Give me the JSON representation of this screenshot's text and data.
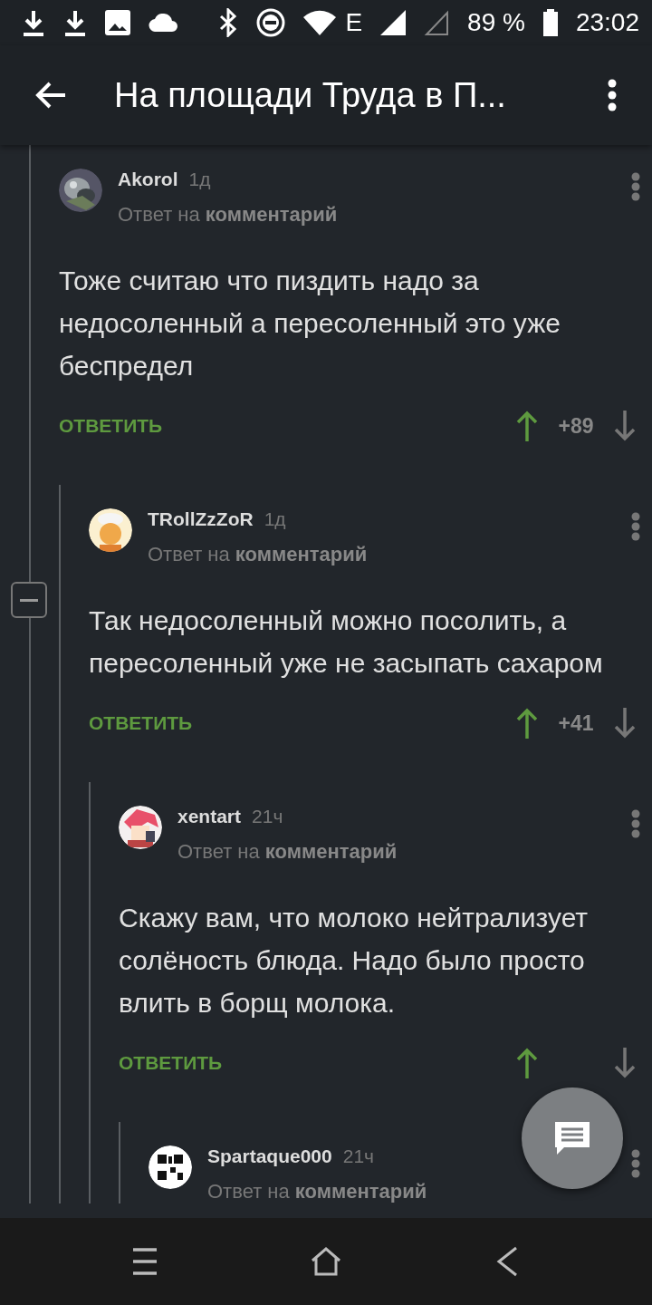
{
  "status_bar": {
    "battery": "89 %",
    "network": "E",
    "time": "23:02"
  },
  "app_bar": {
    "title": "На площади Труда в П..."
  },
  "comments": [
    {
      "author": "Akorol",
      "age": "1д",
      "reply_to": "Ответ на **комментарий**",
      "text": "Тоже считаю что пиздить надо за недосоленный а пересоленный это уже беспредел",
      "reply": "ОТВЕТИТЬ",
      "score": "+89",
      "expanded": true,
      "children": [
        {
          "author": "TRollZzZoR",
          "age": "1д",
          "reply_to": "Ответ на **комментарий**",
          "text": "Так недосоленный можно посолить, а пересоленный уже не засыпать сахаром",
          "reply": "ОТВЕТИТЬ",
          "score": "+41",
          "children": [
            {
              "author": "xentart",
              "age": "21ч",
              "reply_to": "Ответ на **комментарий**",
              "text": "Скажу вам, что молоко нейтрализует солёность блюда. Надо было просто влить в борщ молока.",
              "reply": "ОТВЕТИТЬ",
              "children": [
                {
                  "author": "Spartaque000",
                  "age": "21ч",
                  "reply_to": "Ответ на **комментарий**"
                }
              ]
            }
          ]
        }
      ]
    }
  ]
}
